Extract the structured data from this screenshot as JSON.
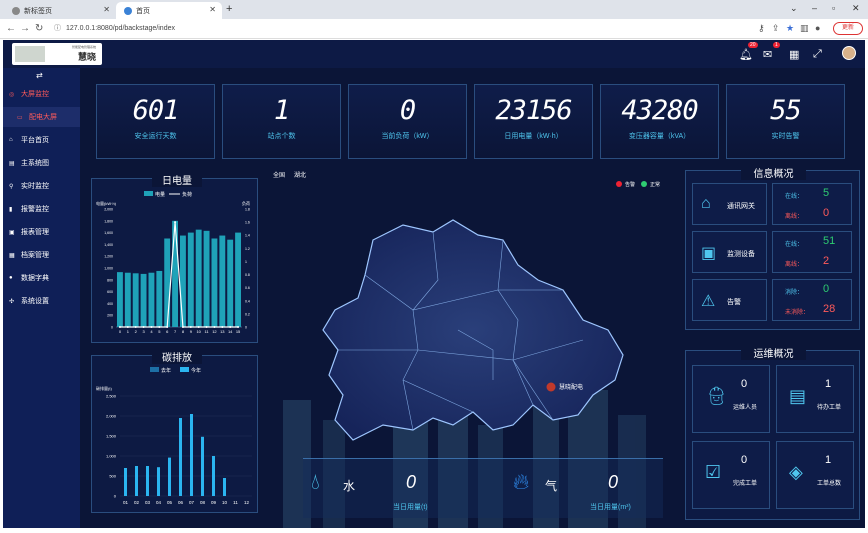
{
  "browser": {
    "tabs": [
      {
        "label": "新标签页"
      },
      {
        "label": "首页"
      }
    ],
    "url": "127.0.0.1:8080/pd/backstage/index",
    "update_label": "更新"
  },
  "app": {
    "logo_name": "慧晓",
    "logo_small": "智能配电管理系统",
    "bell_count": "20",
    "mail_count": "1"
  },
  "sidebar": {
    "items": [
      {
        "label": "大屏监控",
        "icon": "target-icon",
        "active": true
      },
      {
        "label": "配电大屏",
        "icon": "monitor-icon",
        "sub": true
      },
      {
        "label": "平台首页",
        "icon": "home-icon"
      },
      {
        "label": "主系统图",
        "icon": "diagram-icon"
      },
      {
        "label": "实时监控",
        "icon": "pin-icon"
      },
      {
        "label": "报警监控",
        "icon": "alarm-icon"
      },
      {
        "label": "报表管理",
        "icon": "report-icon"
      },
      {
        "label": "档案管理",
        "icon": "archive-icon"
      },
      {
        "label": "数据字典",
        "icon": "dictionary-icon"
      },
      {
        "label": "系统设置",
        "icon": "settings-icon"
      }
    ]
  },
  "stats": [
    {
      "value": "601",
      "label": "安全运行天数"
    },
    {
      "value": "1",
      "label": "站点个数"
    },
    {
      "value": "0",
      "label": "当前负荷（kW）"
    },
    {
      "value": "23156",
      "label": "日用电量（kW·h）"
    },
    {
      "value": "43280",
      "label": "变压器容量（kVA）"
    },
    {
      "value": "55",
      "label": "实时告警"
    }
  ],
  "daily_power": {
    "title": "日电量",
    "legend": [
      "电量",
      "负荷"
    ],
    "ylabel_left": "电量(kW·h)",
    "ylabel_right": "负荷",
    "yticks_left": [
      "0",
      "200",
      "400",
      "600",
      "800",
      "1,000",
      "1,200",
      "1,400",
      "1,600",
      "1,800",
      "2,000"
    ],
    "yticks_right": [
      "0",
      "0.2",
      "0.4",
      "0.6",
      "0.8",
      "1",
      "1.2",
      "1.4",
      "1.6",
      "1.8"
    ]
  },
  "carbon": {
    "title": "碳排放",
    "legend": [
      "去年",
      "今年"
    ],
    "ylabel": "碳排量(t)",
    "yticks": [
      "0",
      "500",
      "1,000",
      "1,500",
      "2,000",
      "2,500"
    ]
  },
  "map": {
    "breadcrumb": [
      "全国",
      "湖北"
    ],
    "legend": [
      "告警",
      "正常"
    ],
    "marker_label": "慧晓配电"
  },
  "info": {
    "title": "信息概况",
    "rows": [
      {
        "label": "通讯网关",
        "a_label": "在线：",
        "a": "5",
        "b_label": "离线：",
        "b": "0"
      },
      {
        "label": "监测设备",
        "a_label": "在线：",
        "a": "51",
        "b_label": "离线：",
        "b": "2"
      },
      {
        "label": "告警",
        "a_label": "消除：",
        "a": "0",
        "b_label": "未消除：",
        "b": "28"
      }
    ]
  },
  "ops": {
    "title": "运维概况",
    "items": [
      {
        "value": "0",
        "label": "运维人员"
      },
      {
        "value": "1",
        "label": "待办工单"
      },
      {
        "value": "0",
        "label": "完成工单"
      },
      {
        "value": "1",
        "label": "工单总数"
      }
    ]
  },
  "bottom": {
    "water_label": "水",
    "water_value": "0",
    "water_unit": "当日用量(t)",
    "gas_label": "气",
    "gas_value": "0",
    "gas_unit": "当日用量(m³)"
  },
  "chart_data": [
    {
      "type": "bar",
      "title": "日电量",
      "categories": [
        "0",
        "1",
        "2",
        "3",
        "4",
        "5",
        "6",
        "7",
        "8",
        "9",
        "10",
        "11",
        "12",
        "13",
        "14",
        "15"
      ],
      "series": [
        {
          "name": "电量",
          "values": [
            930,
            920,
            910,
            900,
            920,
            950,
            1500,
            1800,
            1550,
            1600,
            1650,
            1630,
            1500,
            1550,
            1480,
            1600
          ]
        },
        {
          "name": "负荷",
          "values": [
            0,
            0,
            0,
            0,
            0,
            0,
            0,
            1.6,
            0,
            0,
            0,
            0,
            0,
            0,
            0,
            0
          ]
        }
      ],
      "ylim": [
        0,
        2000
      ]
    },
    {
      "type": "bar",
      "title": "碳排放",
      "categories": [
        "01",
        "02",
        "03",
        "04",
        "05",
        "06",
        "07",
        "08",
        "09",
        "10",
        "11",
        "12"
      ],
      "series": [
        {
          "name": "去年",
          "values": [
            0,
            0,
            0,
            0,
            0,
            0,
            0,
            0,
            0,
            0,
            0,
            0
          ]
        },
        {
          "name": "今年",
          "values": [
            700,
            750,
            750,
            720,
            960,
            1950,
            2050,
            1480,
            1000,
            450,
            0,
            0
          ]
        }
      ],
      "ylim": [
        0,
        2500
      ]
    }
  ]
}
